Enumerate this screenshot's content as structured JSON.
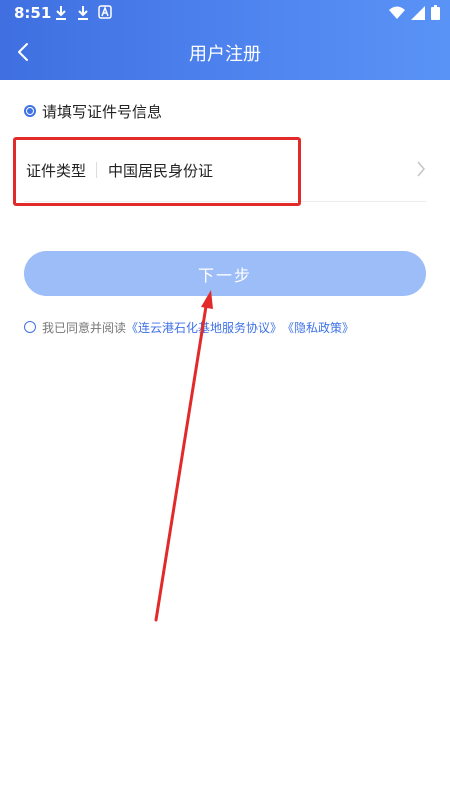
{
  "status_bar": {
    "time": "8:51",
    "left_icons": [
      "download-icon",
      "download-icon",
      "app-a-icon"
    ],
    "right_icons": [
      "wifi-icon",
      "signal-icon",
      "battery-icon"
    ]
  },
  "header": {
    "title": "用户注册",
    "back_icon": "chevron-left-icon",
    "gradient_colors": [
      "#3f6fe0",
      "#5a93f6"
    ]
  },
  "section": {
    "label": "请填写证件号信息"
  },
  "id_type": {
    "label": "证件类型",
    "value": "中国居民身份证"
  },
  "next_button": {
    "label": "下一步",
    "color": "#9cbdf8"
  },
  "agreement": {
    "prefix": "我已同意并阅读",
    "service_link": "《连云港石化基地服务协议》",
    "privacy_link": "《隐私政策》"
  },
  "annotation": {
    "highlight_color": "#e32a2a"
  }
}
